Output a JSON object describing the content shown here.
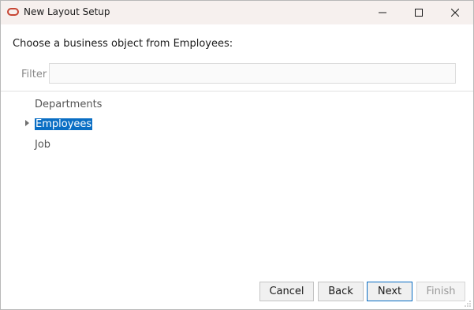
{
  "window": {
    "title": "New Layout Setup",
    "icon": "oracle-logo-icon"
  },
  "controls": {
    "minimize": "minimize-icon",
    "maximize": "maximize-icon",
    "close": "close-icon"
  },
  "main": {
    "prompt": "Choose a business object from Employees:",
    "filter": {
      "label": "Filter",
      "value": "",
      "placeholder": ""
    },
    "tree": {
      "items": [
        {
          "label": "Departments",
          "expandable": false,
          "selected": false
        },
        {
          "label": "Employees",
          "expandable": true,
          "selected": true
        },
        {
          "label": "Job",
          "expandable": false,
          "selected": false
        }
      ]
    }
  },
  "footer": {
    "cancel_label": "Cancel",
    "back_label": "Back",
    "next_label": "Next",
    "finish_label": "Finish",
    "finish_enabled": false
  },
  "colors": {
    "titlebar": "#f6f0ee",
    "selection": "#0a6ec4",
    "oracle_red": "#c74634"
  }
}
